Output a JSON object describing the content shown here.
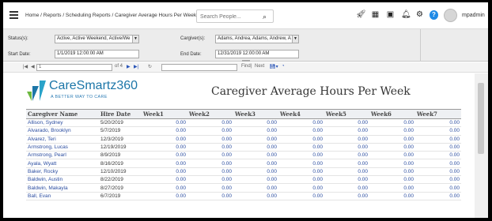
{
  "breadcrumb": "Home / Reports / Scheduling Reports / Caregiver Average Hours Per Week",
  "search": {
    "placeholder": "Search People..."
  },
  "user": {
    "name": "mpadmin"
  },
  "params": {
    "status_label": "Status(s):",
    "status_value": "Active, Active Weekend, Active/We",
    "caregiver_label": "Cargiver(s):",
    "caregiver_value": "Adams, Andrea, Adams, Andrew, A",
    "start_label": "Start Date:",
    "start_value": "1/1/2019 12:00:00 AM",
    "end_label": "End Date:",
    "end_value": "12/31/2019 12:00:00 AM"
  },
  "toolbar": {
    "page": "1",
    "of": "of 4",
    "find": "Find",
    "next": "Next"
  },
  "report": {
    "logo_text": "CareSmartz360",
    "logo_tagline": "A BETTER WAY TO CARE",
    "title": "Caregiver Average Hours Per Week",
    "columns": [
      "Caregiver Name",
      "Hire Date",
      "Week1",
      "Week2",
      "Week3",
      "Week4",
      "Week5",
      "Week6",
      "Week7"
    ],
    "rows": [
      {
        "name": "Allison, Sydney",
        "hire": "5/20/2019",
        "w": [
          "0.00",
          "0.00",
          "0.00",
          "0.00",
          "0.00",
          "0.00",
          "0.00"
        ]
      },
      {
        "name": "Alvarado, Brooklyn",
        "hire": "5/7/2019",
        "w": [
          "0.00",
          "0.00",
          "0.00",
          "0.00",
          "0.00",
          "0.00",
          "0.00"
        ]
      },
      {
        "name": "Alvarez, Teri",
        "hire": "12/3/2019",
        "w": [
          "0.00",
          "0.00",
          "0.00",
          "0.00",
          "0.00",
          "0.00",
          "0.00"
        ]
      },
      {
        "name": "Armstrong, Lucas",
        "hire": "12/19/2019",
        "w": [
          "0.00",
          "0.00",
          "0.00",
          "0.00",
          "0.00",
          "0.00",
          "0.00"
        ]
      },
      {
        "name": "Armstrong, Pearl",
        "hire": "8/9/2019",
        "w": [
          "0.00",
          "0.00",
          "0.00",
          "0.00",
          "0.00",
          "0.00",
          "0.00"
        ]
      },
      {
        "name": "Ayala, Wyatt",
        "hire": "8/16/2019",
        "w": [
          "0.00",
          "0.00",
          "0.00",
          "0.00",
          "0.00",
          "0.00",
          "0.00"
        ]
      },
      {
        "name": "Baker, Rocky",
        "hire": "12/10/2019",
        "w": [
          "0.00",
          "0.00",
          "0.00",
          "0.00",
          "0.00",
          "0.00",
          "0.00"
        ]
      },
      {
        "name": "Baldwin, Austin",
        "hire": "8/22/2019",
        "w": [
          "0.00",
          "0.00",
          "0.00",
          "0.00",
          "0.00",
          "0.00",
          "0.00"
        ]
      },
      {
        "name": "Baldwin, Makayla",
        "hire": "8/27/2019",
        "w": [
          "0.00",
          "0.00",
          "0.00",
          "0.00",
          "0.00",
          "0.00",
          "0.00"
        ]
      },
      {
        "name": "Ball, Evan",
        "hire": "6/7/2019",
        "w": [
          "0.00",
          "0.00",
          "0.00",
          "0.00",
          "0.00",
          "0.00",
          "0.00"
        ]
      }
    ]
  },
  "colors": {
    "accent": "#1e8ae6",
    "link": "#2b4da0",
    "logo": "#1c76a8"
  },
  "icons": [
    "menu-icon",
    "search-icon",
    "rocket-icon",
    "calendar-icon",
    "id-card-icon",
    "bell-icon",
    "gear-icon",
    "help-icon"
  ]
}
